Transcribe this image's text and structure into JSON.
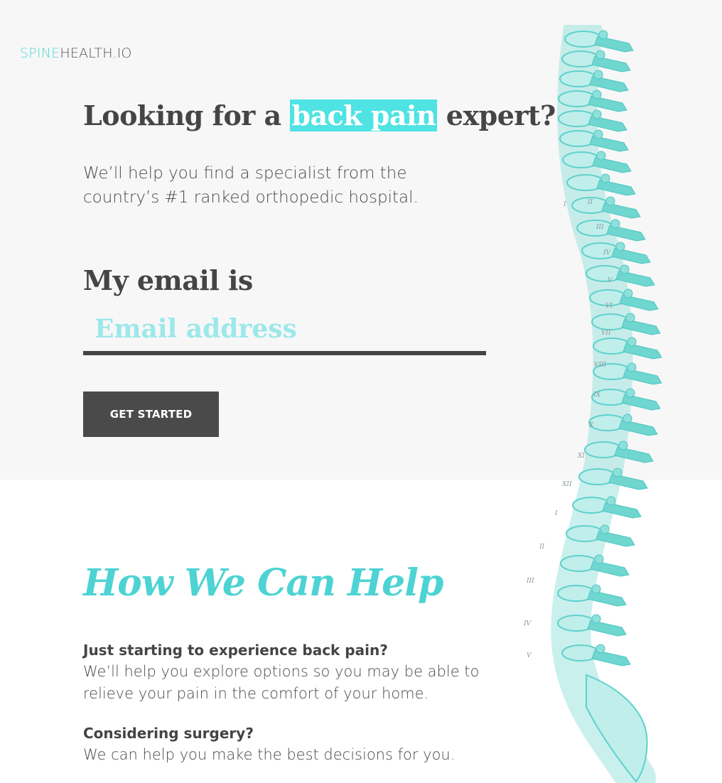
{
  "brand": {
    "logo_part1": "SPINE",
    "logo_part2": "HEALTH.IO"
  },
  "hero": {
    "headline_before": "Looking for a ",
    "headline_highlight": "back pain",
    "headline_after": " expert?",
    "subhead": "We’ll help you find a specialist from the country’s #1 ranked orthopedic hospital.",
    "email_label": "My email is",
    "email_placeholder": "Email address",
    "email_value": "",
    "cta_label": "GET STARTED"
  },
  "help": {
    "title": "How We Can Help",
    "items": [
      {
        "question": "Just starting to experience back pain?",
        "answer": "We’ll help you explore options so you may be able to relieve your pain in the comfort of your home."
      },
      {
        "question": "Considering surgery?",
        "answer": "We can help you make the best decisions for you."
      }
    ]
  },
  "spine_labels": [
    "I",
    "II",
    "III",
    "IV",
    "V",
    "VI",
    "VII",
    "VIII",
    "IX",
    "X",
    "XI",
    "XII",
    "I",
    "II",
    "III",
    "IV",
    "V"
  ],
  "colors": {
    "accent": "#4dd8d8",
    "highlight": "#4fe3e3",
    "dark": "#4a4a4a",
    "hero_bg": "#f7f7f7",
    "spine": "#5fd1cc"
  },
  "icons": {
    "spine_illustration": "spine-illustration"
  }
}
